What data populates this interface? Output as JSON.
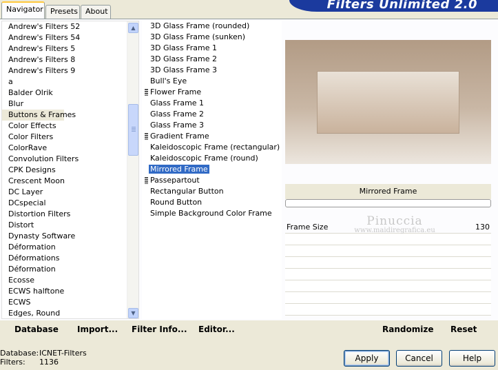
{
  "tabs": [
    "Navigator",
    "Presets",
    "About"
  ],
  "banner": "Filters Unlimited 2.0",
  "categories": {
    "items": [
      "Andrew's Filters 52",
      "Andrew's Filters 54",
      "Andrew's Filters 5",
      "Andrew's Filters 8",
      "Andrew's Filters 9",
      "a",
      "Balder Olrik",
      "Blur",
      "Buttons & Frames",
      "Color Effects",
      "Color Filters",
      "ColorRave",
      "Convolution Filters",
      "CPK Designs",
      "Crescent Moon",
      "DC Layer",
      "DCspecial",
      "Distortion Filters",
      "Distort",
      "Dynasty Software",
      "Déformation",
      "Déformations",
      "Déformation",
      "Ecosse",
      "ECWS halftone",
      "ECWS",
      "Edges, Round"
    ],
    "selected": "Buttons & Frames"
  },
  "filters": {
    "items": [
      {
        "label": "3D Glass Frame (rounded)",
        "grip": false
      },
      {
        "label": "3D Glass Frame (sunken)",
        "grip": false
      },
      {
        "label": "3D Glass Frame 1",
        "grip": false
      },
      {
        "label": "3D Glass Frame 2",
        "grip": false
      },
      {
        "label": "3D Glass Frame 3",
        "grip": false
      },
      {
        "label": "Bull's Eye",
        "grip": false
      },
      {
        "label": "Flower Frame",
        "grip": true
      },
      {
        "label": "Glass Frame 1",
        "grip": false
      },
      {
        "label": "Glass Frame 2",
        "grip": false
      },
      {
        "label": "Glass Frame 3",
        "grip": false
      },
      {
        "label": "Gradient Frame",
        "grip": true
      },
      {
        "label": "Kaleidoscopic Frame (rectangular)",
        "grip": false
      },
      {
        "label": "Kaleidoscopic Frame (round)",
        "grip": false
      },
      {
        "label": "Mirrored Frame",
        "grip": false
      },
      {
        "label": "Passepartout",
        "grip": true
      },
      {
        "label": "Rectangular Button",
        "grip": false
      },
      {
        "label": "Round Button",
        "grip": false
      },
      {
        "label": "Simple Background Color Frame",
        "grip": false
      }
    ],
    "selected": "Mirrored Frame"
  },
  "preview": {
    "filter_name": "Mirrored Frame",
    "param_label": "Frame Size",
    "param_value": "130"
  },
  "watermark": {
    "line1": "Pinuccia",
    "line2": "www.maidiregrafica.eu"
  },
  "bottom_bar": {
    "database": "Database",
    "import": "Import...",
    "filter_info": "Filter Info...",
    "editor": "Editor...",
    "randomize": "Randomize",
    "reset": "Reset"
  },
  "status": {
    "database_label": "Database:",
    "database_value": "ICNET-Filters",
    "filters_label": "Filters:",
    "filters_value": "1136"
  },
  "buttons": {
    "apply": "Apply",
    "cancel": "Cancel",
    "help": "Help"
  }
}
